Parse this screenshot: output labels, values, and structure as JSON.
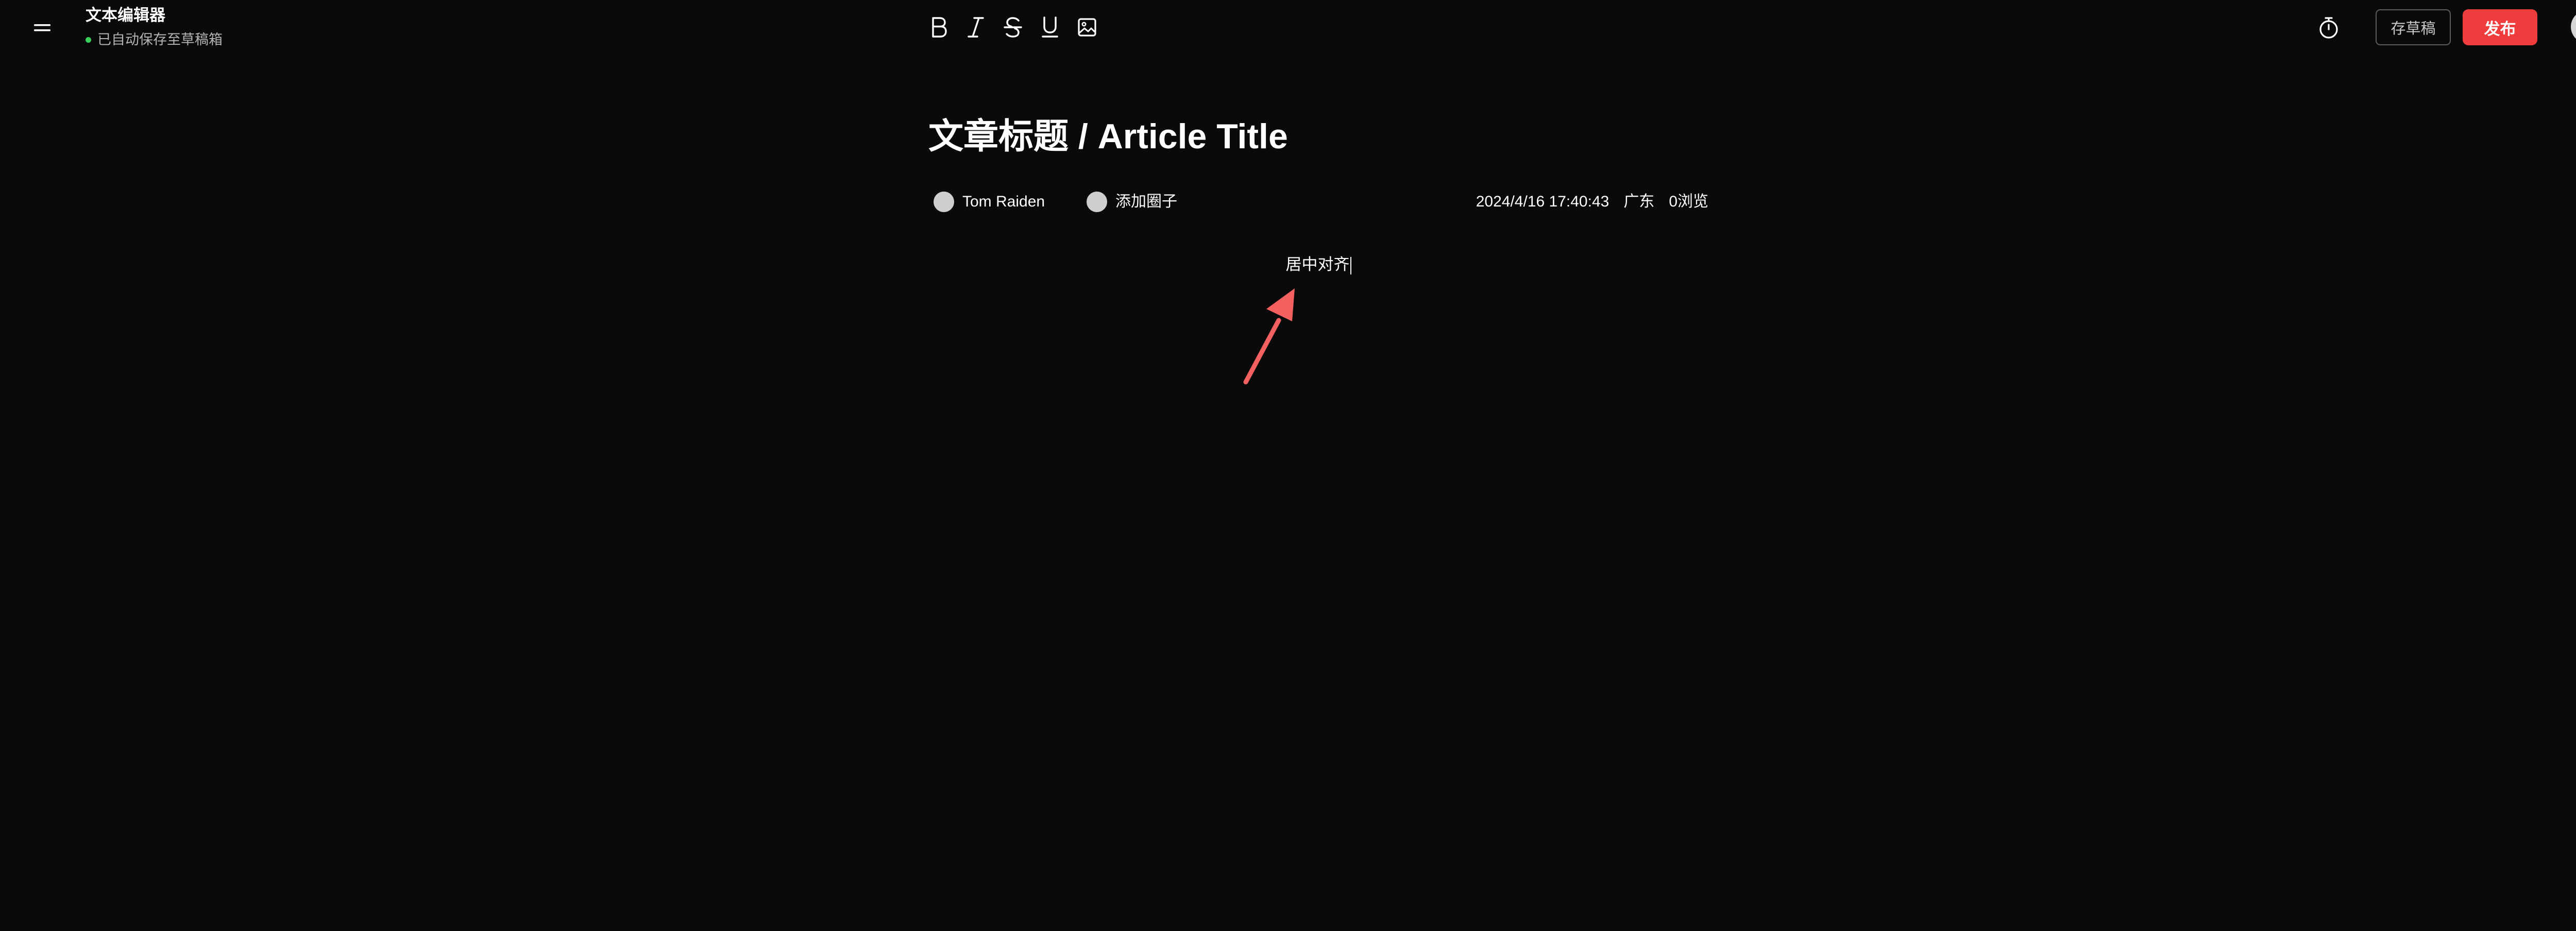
{
  "app": {
    "title": "文本编辑器",
    "save_status": "已自动保存至草稿箱"
  },
  "toolbar": {
    "tools": [
      {
        "name": "bold-icon",
        "label": "B"
      },
      {
        "name": "italic-icon",
        "label": "I"
      },
      {
        "name": "strikethrough-icon",
        "label": "S"
      },
      {
        "name": "underline-icon",
        "label": "U"
      },
      {
        "name": "image-icon",
        "label": ""
      }
    ]
  },
  "actions": {
    "save_draft_label": "存草稿",
    "publish_label": "发布"
  },
  "article": {
    "title": "文章标题 / Article Title",
    "author_name": "Tom Raiden",
    "add_circle_label": "添加圈子",
    "datetime": "2024/4/16 17:40:43",
    "location": "广东",
    "views": "0浏览",
    "body_text": "居中对齐"
  },
  "colors": {
    "background": "#0a0a0b",
    "accent_red": "#ef3d3d",
    "status_green": "#3ad15c",
    "annotation_arrow": "#f26060"
  }
}
